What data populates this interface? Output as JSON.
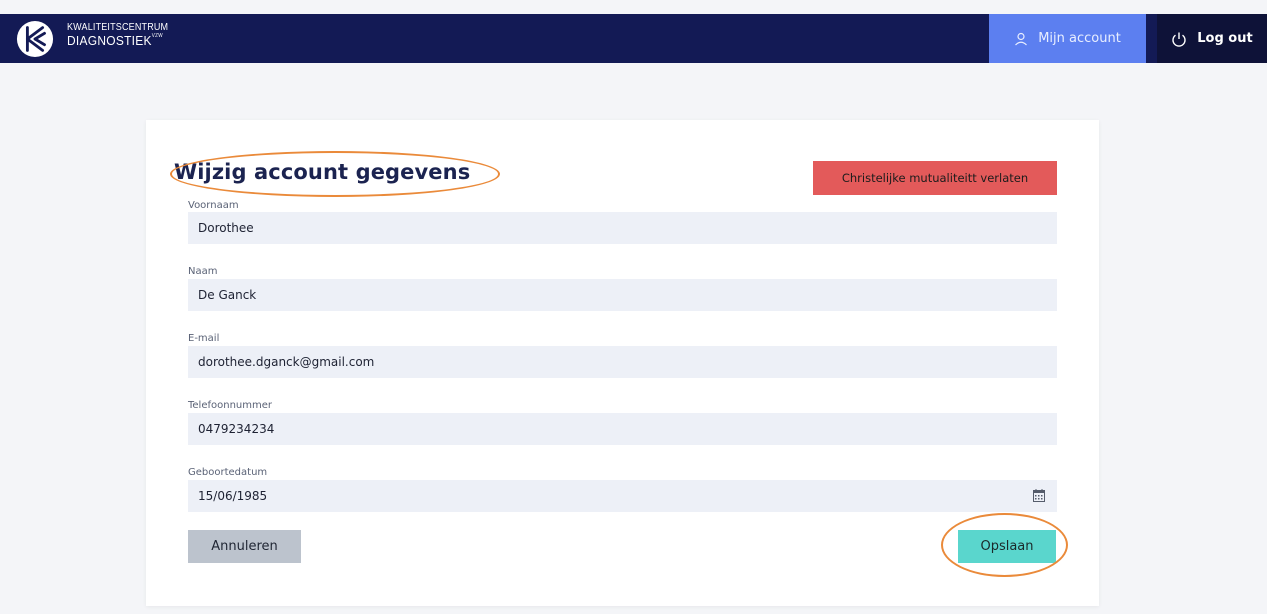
{
  "header": {
    "logo_line1": "KWALITEITSCENTRUM",
    "logo_line2": "DIAGNOSTIEK",
    "logo_mark": "VZW",
    "account_label": "Mijn account",
    "logout_label": "Log out",
    "account_icon": "user-icon",
    "logout_icon": "power-icon"
  },
  "form": {
    "title": "Wijzig account gegevens",
    "leave_button": "Christelijke mutualiteitt verlaten",
    "fields": [
      {
        "label": "Voornaam",
        "value": "Dorothee"
      },
      {
        "label": "Naam",
        "value": "De Ganck"
      },
      {
        "label": "E-mail",
        "value": "dorothee.dganck@gmail.com"
      },
      {
        "label": "Telefoonnummer",
        "value": "0479234234"
      },
      {
        "label": "Geboortedatum",
        "value": "15/06/1985"
      }
    ],
    "date_icon": "calendar-icon",
    "cancel_button": "Annuleren",
    "save_button": "Opslaan"
  },
  "colors": {
    "header_bg": "#131a55",
    "account_bg": "#5c7ff0",
    "logout_bg": "#0e1238",
    "leave_bg": "#e35a5a",
    "save_bg": "#5ad6cd",
    "cancel_bg": "#bcc3cd",
    "highlight": "#ea8a3a"
  }
}
